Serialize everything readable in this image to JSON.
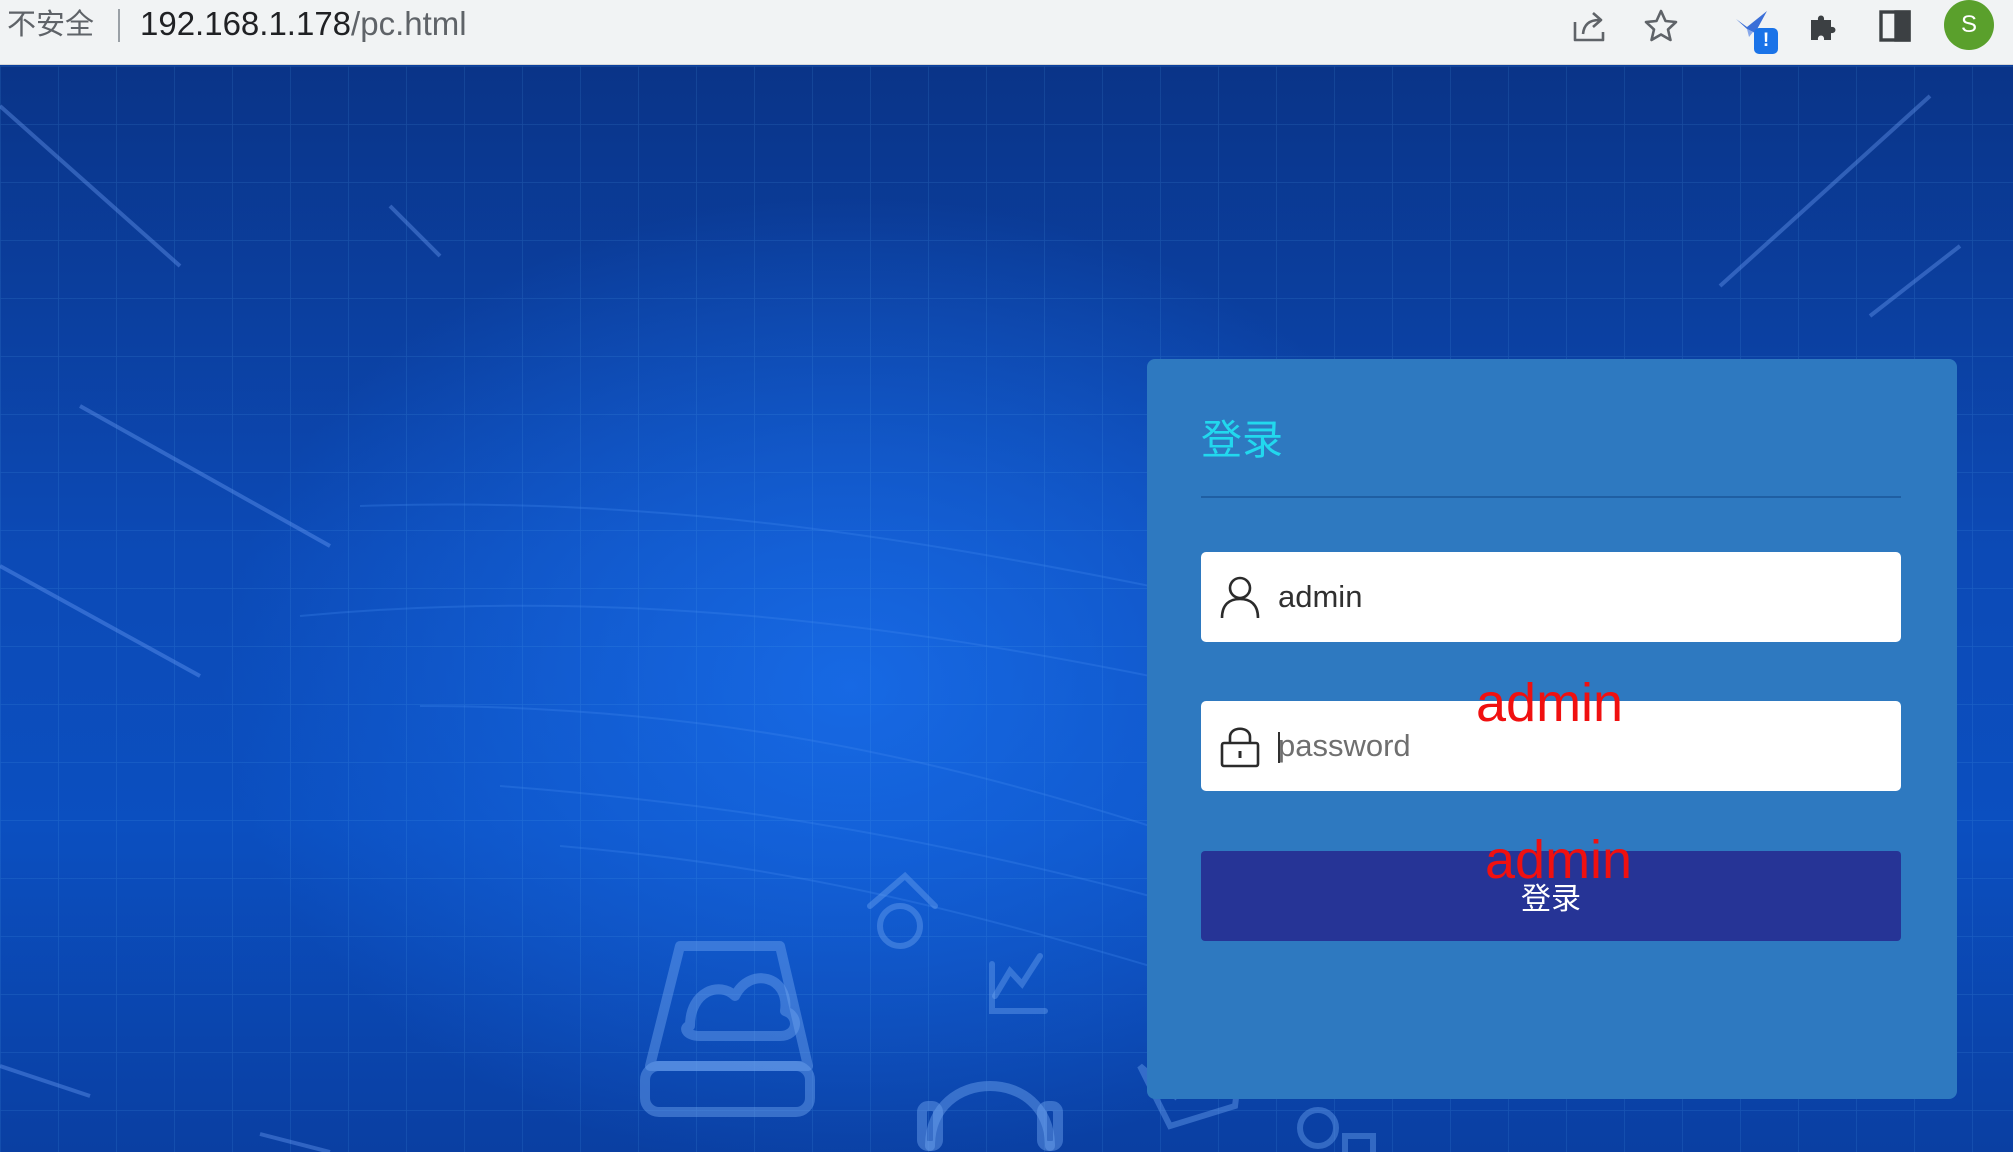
{
  "browser": {
    "security_label": "不安全",
    "url_host": "192.168.1.178",
    "url_path": "/pc.html",
    "icons": [
      "share-icon",
      "star-icon",
      "extension-bird-icon",
      "puzzle-icon",
      "side-panel-icon"
    ],
    "extension_badge": "!",
    "profile_initial": "S"
  },
  "login": {
    "title": "登录",
    "username": {
      "value": "admin",
      "icon": "user-icon"
    },
    "password": {
      "placeholder": "password",
      "icon": "lock-icon"
    },
    "submit_label": "登录"
  },
  "annotations": {
    "username_note": "admin",
    "password_note": "admin"
  },
  "colors": {
    "page_background": "#0b4fc0",
    "panel": "#2e79c0",
    "title": "#22d8ee",
    "button": "#263496",
    "annotation": "#f01010"
  }
}
